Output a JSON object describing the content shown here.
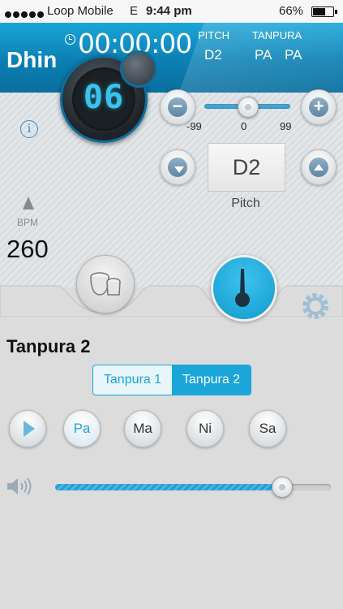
{
  "status_bar": {
    "carrier": "Loop Mobile",
    "network": "E",
    "time": "9:44 pm",
    "battery": "66%",
    "battery_fraction": 0.66
  },
  "header": {
    "rhythm_name": "Dhin",
    "timer": "00:00:00",
    "pitch_label": "PITCH",
    "pitch_value": "D2",
    "tanpura_label": "TANPURA",
    "tanpura_value_1": "PA",
    "tanpura_value_2": "PA",
    "beat_display": "06"
  },
  "tuning": {
    "minus_label": "−",
    "plus_label": "+",
    "min_label": "-99",
    "mid_label": "0",
    "max_label": "99",
    "value_fraction": 0.5,
    "pitch_value": "D2",
    "pitch_caption": "Pitch"
  },
  "tempo": {
    "bpm_label": "BPM",
    "bpm_value": "260"
  },
  "tanpura": {
    "title": "Tanpura 2",
    "tab_1": "Tanpura 1",
    "tab_2": "Tanpura 2",
    "notes": [
      "Pa",
      "Ma",
      "Ni",
      "Sa"
    ],
    "active_note": "Pa",
    "volume_fraction": 0.82
  },
  "colors": {
    "accent": "#1aa6d8",
    "header_bg": "#0b7fb3"
  },
  "icons": {
    "timer": "clock-icon",
    "info": "info-icon",
    "metronome": "metronome-icon",
    "drum": "drum-icon",
    "tanpura": "tanpura-icon",
    "settings": "gear-icon",
    "volume": "speaker-icon",
    "play": "play-icon"
  }
}
